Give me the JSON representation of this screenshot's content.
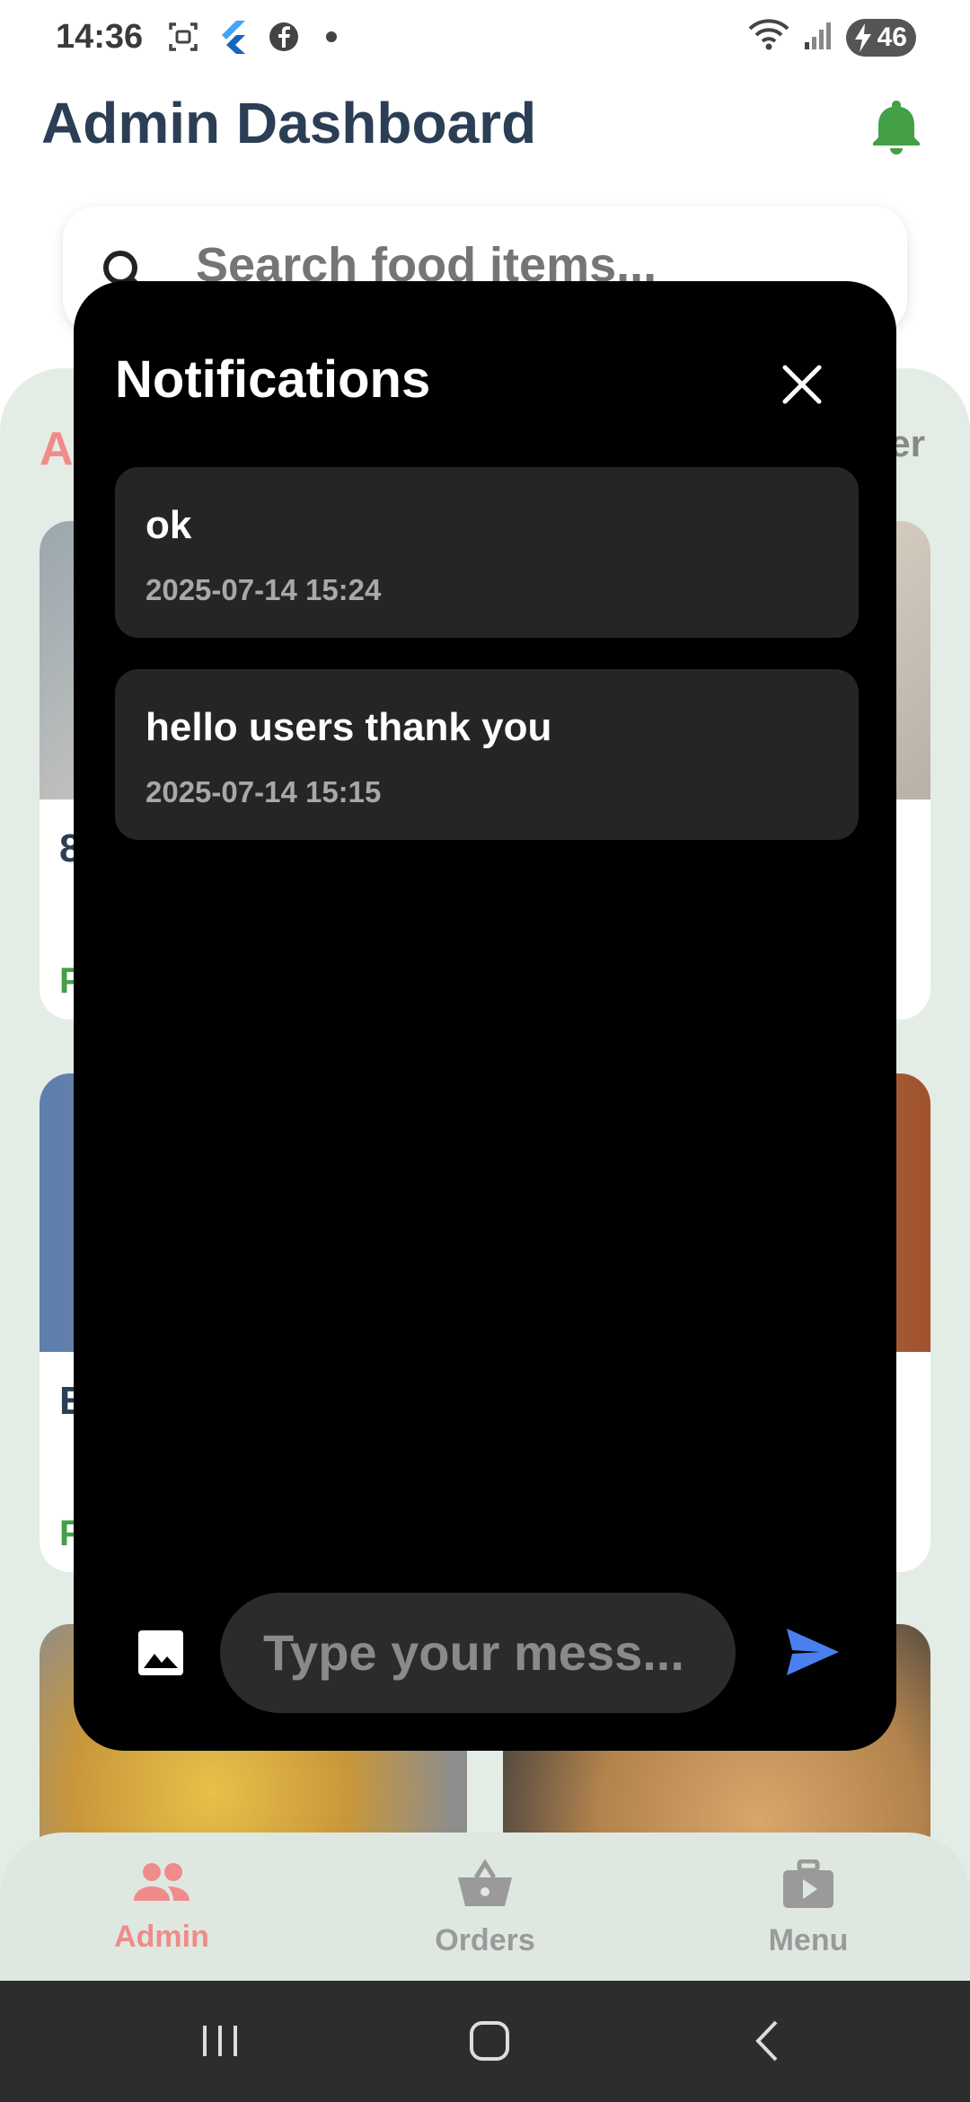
{
  "status_bar": {
    "time": "14:36",
    "battery": "46",
    "icons": [
      "screenshot-icon",
      "flutter-icon",
      "facebook-icon",
      "dot-icon",
      "wifi-icon",
      "signal-icon",
      "battery-charging-icon"
    ]
  },
  "header": {
    "title": "Admin Dashboard",
    "bell_icon": "notification-bell-icon",
    "bell_color": "#43a047"
  },
  "search": {
    "placeholder": "Search food items..."
  },
  "background": {
    "chip_left": "A",
    "chip_right": "er",
    "cards": [
      {
        "title": "8",
        "price": "P"
      },
      {
        "title": "E",
        "price": "P"
      }
    ]
  },
  "notifications_modal": {
    "title": "Notifications",
    "close_icon": "close-icon",
    "items": [
      {
        "message": "ok",
        "time": "2025-07-14 15:24"
      },
      {
        "message": "hello users thank you",
        "time": "2025-07-14 15:15"
      }
    ],
    "composer": {
      "image_icon": "image-icon",
      "placeholder": "Type your mess...",
      "send_icon": "send-icon",
      "send_color": "#4a7ff0"
    }
  },
  "bottom_nav": {
    "items": [
      {
        "label": "Admin",
        "icon": "people-icon",
        "active": true
      },
      {
        "label": "Orders",
        "icon": "basket-icon",
        "active": false
      },
      {
        "label": "Menu",
        "icon": "video-bag-icon",
        "active": false
      }
    ],
    "active_color": "#f08b8b",
    "inactive_color": "#9a9a9a"
  },
  "system_nav": {
    "buttons": [
      "recent-apps-icon",
      "home-icon",
      "back-icon"
    ]
  }
}
